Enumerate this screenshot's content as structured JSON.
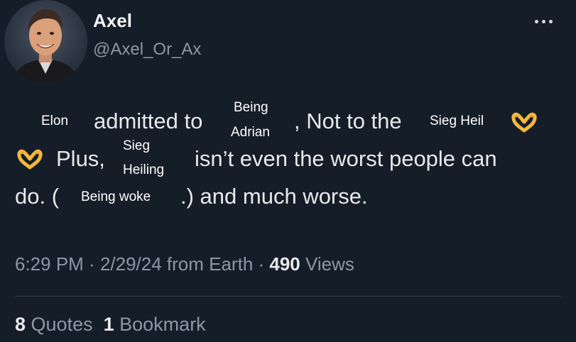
{
  "author": {
    "name": "Axel",
    "handle": "@Axel_Or_Ax",
    "avatar_icon": "profile-photo"
  },
  "tweet": {
    "overlay_elon": "Elon",
    "text_admitted_to": "admitted to",
    "overlay_being": "Being",
    "overlay_adrian": "Adrian",
    "text_comma_not": ", Not to the",
    "overlay_sieg_heil": "Sieg Heil",
    "text_plus": "Plus,",
    "overlay_sieg": "Sieg",
    "overlay_heiling": "Heiling",
    "text_isnt": "isn’t even the worst people can",
    "text_do": "do. (",
    "overlay_being_woke": "Being woke",
    "text_and_much_worse": ".) and much worse.",
    "emoji": "heart-hands-icon"
  },
  "meta": {
    "time": "6:29 PM",
    "sep1": " · ",
    "date": "2/29/24",
    "source": " from Earth",
    "sep2": " · ",
    "views_count": "490",
    "views_label": " Views"
  },
  "stats": {
    "quotes_count": "8",
    "quotes_label": " Quotes",
    "bookmarks_count": "1",
    "bookmarks_label": " Bookmark"
  },
  "colors": {
    "background": "#151d28",
    "secondary_text": "#8b98a5",
    "primary_text": "#e7e9ea",
    "emoji": "#f5b83d"
  }
}
